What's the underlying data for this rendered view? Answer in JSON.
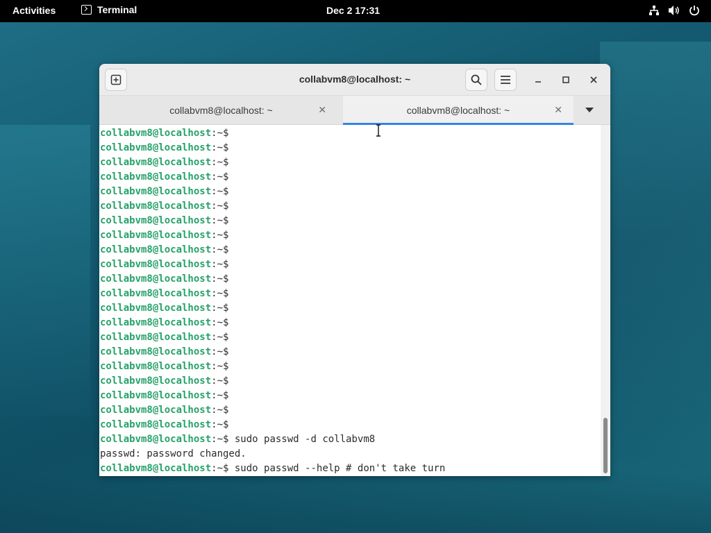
{
  "topbar": {
    "activities": "Activities",
    "app_name": "Terminal",
    "clock": "Dec 2  17:31",
    "icons": [
      "network-icon",
      "volume-icon",
      "power-icon"
    ]
  },
  "window": {
    "title": "collabvm8@localhost: ~",
    "tabs": [
      {
        "label": "collabvm8@localhost: ~",
        "active": false
      },
      {
        "label": "collabvm8@localhost: ~",
        "active": true
      }
    ],
    "accent": "#3584e4"
  },
  "terminal": {
    "prompt_user": "collabvm8@localhost",
    "prompt_path": ":~$",
    "prompt_color": "#26a269",
    "empty_prompt_count": 21,
    "lines": [
      {
        "type": "prompt",
        "cmd": ""
      },
      {
        "type": "prompt",
        "cmd": ""
      },
      {
        "type": "prompt",
        "cmd": ""
      },
      {
        "type": "prompt",
        "cmd": ""
      },
      {
        "type": "prompt",
        "cmd": ""
      },
      {
        "type": "prompt",
        "cmd": ""
      },
      {
        "type": "prompt",
        "cmd": ""
      },
      {
        "type": "prompt",
        "cmd": ""
      },
      {
        "type": "prompt",
        "cmd": ""
      },
      {
        "type": "prompt",
        "cmd": ""
      },
      {
        "type": "prompt",
        "cmd": ""
      },
      {
        "type": "prompt",
        "cmd": ""
      },
      {
        "type": "prompt",
        "cmd": ""
      },
      {
        "type": "prompt",
        "cmd": ""
      },
      {
        "type": "prompt",
        "cmd": ""
      },
      {
        "type": "prompt",
        "cmd": ""
      },
      {
        "type": "prompt",
        "cmd": ""
      },
      {
        "type": "prompt",
        "cmd": ""
      },
      {
        "type": "prompt",
        "cmd": ""
      },
      {
        "type": "prompt",
        "cmd": ""
      },
      {
        "type": "prompt",
        "cmd": ""
      },
      {
        "type": "prompt",
        "cmd": " sudo passwd -d collabvm8"
      },
      {
        "type": "output",
        "text": "passwd: password changed."
      },
      {
        "type": "prompt",
        "cmd": " sudo passwd --help # don't take turn"
      }
    ]
  }
}
